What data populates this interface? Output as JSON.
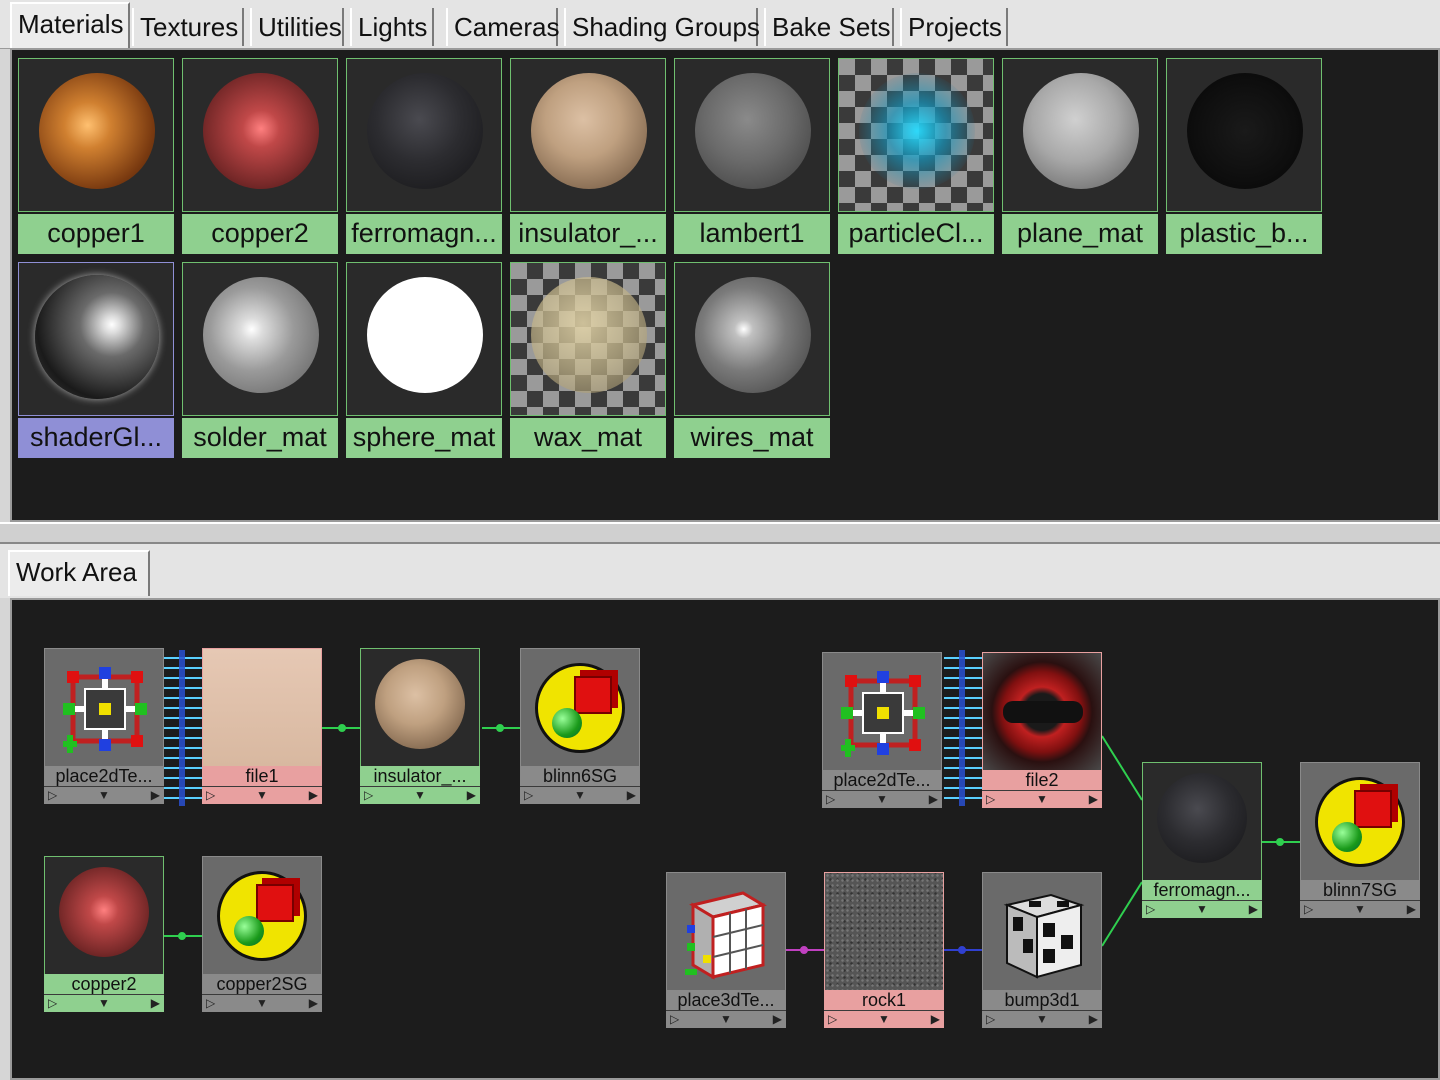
{
  "tabs": [
    {
      "label": "Materials",
      "active": true
    },
    {
      "label": "Textures"
    },
    {
      "label": "Utilities"
    },
    {
      "label": "Lights"
    },
    {
      "label": "Cameras"
    },
    {
      "label": "Shading Groups"
    },
    {
      "label": "Bake Sets"
    },
    {
      "label": "Projects"
    }
  ],
  "materials": [
    {
      "label": "copper1",
      "style": "copper1"
    },
    {
      "label": "copper2",
      "style": "copper2"
    },
    {
      "label": "ferromagn...",
      "style": "ferro"
    },
    {
      "label": "insulator_...",
      "style": "insulator"
    },
    {
      "label": "lambert1",
      "style": "lambert"
    },
    {
      "label": "particleCl...",
      "style": "particle"
    },
    {
      "label": "plane_mat",
      "style": "plane"
    },
    {
      "label": "plastic_b...",
      "style": "plastic"
    },
    {
      "label": "shaderGl...",
      "style": "glow",
      "selected": true
    },
    {
      "label": "solder_mat",
      "style": "solder"
    },
    {
      "label": "sphere_mat",
      "style": "sphere"
    },
    {
      "label": "wax_mat",
      "style": "wax"
    },
    {
      "label": "wires_mat",
      "style": "wires"
    }
  ],
  "work_area": {
    "tab_label": "Work Area",
    "nodes": {
      "place2d_1": "place2dTe...",
      "file1": "file1",
      "insulator": "insulator_...",
      "blinn6sg": "blinn6SG",
      "copper2": "copper2",
      "copper2sg": "copper2SG",
      "place2d_2": "place2dTe...",
      "file2": "file2",
      "ferromagn": "ferromagn...",
      "blinn7sg": "blinn7SG",
      "place3d": "place3dTe...",
      "rock1": "rock1",
      "bump3d1": "bump3d1"
    }
  },
  "colors": {
    "material_label": "#8fd08f",
    "selected_label": "#8f8fd6",
    "texture_label": "#e8a0a0",
    "panel_bg": "#1c1c1c"
  }
}
